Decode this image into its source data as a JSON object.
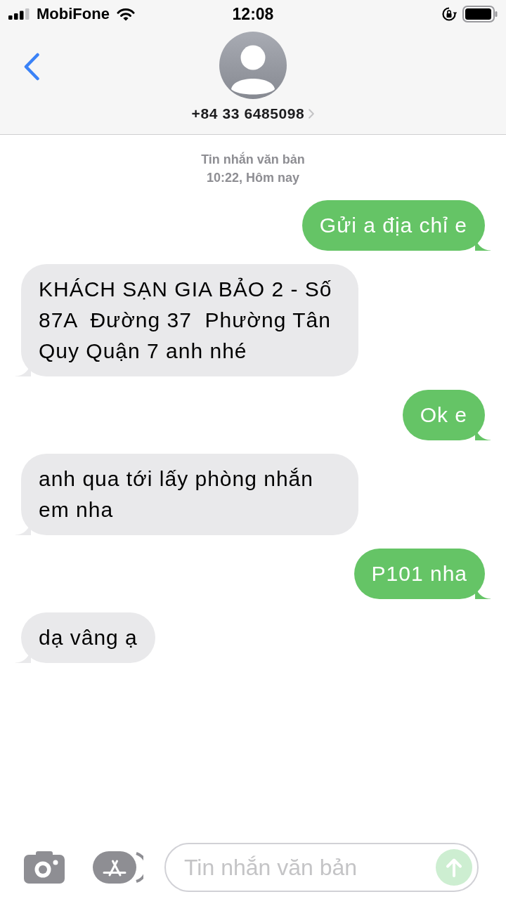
{
  "status_bar": {
    "carrier": "MobiFone",
    "time": "12:08"
  },
  "header": {
    "contact": "+84 33 6485098"
  },
  "thread": {
    "service": "Tin nhắn văn bản",
    "timestamp": "10:22, Hôm nay"
  },
  "messages": [
    {
      "kind": "sent",
      "text": "Gửi a địa chỉ e"
    },
    {
      "kind": "received",
      "text": "KHÁCH SẠN GIA BẢO 2 - Số 87A  Đường 37  Phường Tân Quy Quận 7 anh nhé"
    },
    {
      "kind": "sent",
      "text": "Ok e"
    },
    {
      "kind": "received",
      "text": "anh qua tới lấy phòng nhắn em nha"
    },
    {
      "kind": "sent",
      "text": "P101 nha"
    },
    {
      "kind": "received",
      "text": "dạ vâng ạ"
    }
  ],
  "composer": {
    "placeholder": "Tin nhắn văn bản",
    "send_button": {
      "disabled": true
    }
  }
}
